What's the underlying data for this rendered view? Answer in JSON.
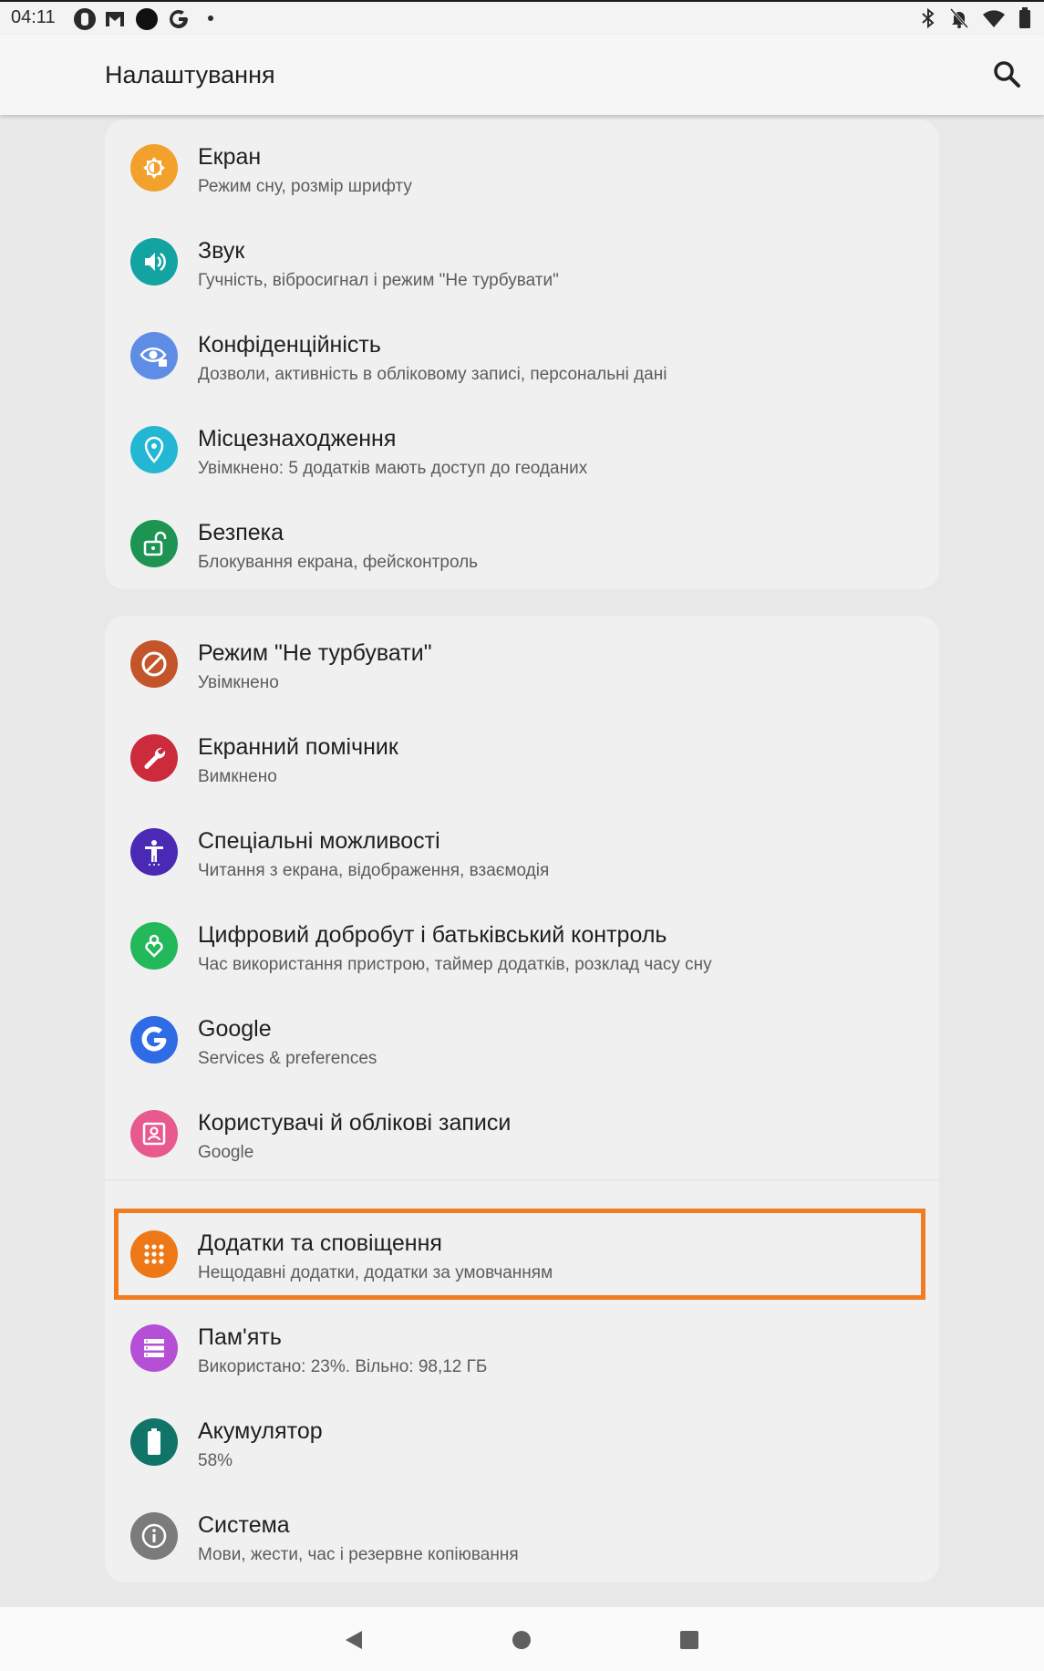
{
  "status_bar": {
    "time": "04:11",
    "left_icons": [
      "notification-icon",
      "gmail-icon",
      "circle-icon",
      "google-icon",
      "dot-icon"
    ],
    "right_icons": [
      "bluetooth-icon",
      "notifications-off-icon",
      "wifi-icon",
      "battery-icon"
    ]
  },
  "app_bar": {
    "title": "Налаштування",
    "search_icon": "search-icon"
  },
  "groups": [
    {
      "items": [
        {
          "title": "Екран",
          "subtitle": "Режим сну, розмір шрифту",
          "icon": "brightness-icon",
          "color": "#f2a22c"
        },
        {
          "title": "Звук",
          "subtitle": "Гучність, вібросигнал і режим \"Не турбувати\"",
          "icon": "volume-icon",
          "color": "#13a3a1"
        },
        {
          "title": "Конфіденційність",
          "subtitle": "Дозволи, активність в обліковому записі, персональні дані",
          "icon": "privacy-eye-icon",
          "color": "#5f8de6"
        },
        {
          "title": "Місцезнаходження",
          "subtitle": "Увімкнено: 5 додатків мають доступ до геоданих",
          "icon": "location-pin-icon",
          "color": "#24b7d3"
        },
        {
          "title": "Безпека",
          "subtitle": "Блокування екрана, фейсконтроль",
          "icon": "unlock-icon",
          "color": "#1d9452"
        }
      ]
    },
    {
      "items": [
        {
          "title": "Режим \"Не турбувати\"",
          "subtitle": "Увімкнено",
          "icon": "do-not-disturb-icon",
          "color": "#c4552a"
        },
        {
          "title": "Екранний помічник",
          "subtitle": "Вимкнено",
          "icon": "wrench-icon",
          "color": "#cc2b3c"
        },
        {
          "title": "Спеціальні можливості",
          "subtitle": "Читання з екрана, відображення, взаємодія",
          "icon": "accessibility-icon",
          "color": "#4a2ab4"
        },
        {
          "title": "Цифровий добробут і батьківський контроль",
          "subtitle": "Час використання пристрою, таймер додатків, розклад часу сну",
          "icon": "wellbeing-heart-icon",
          "color": "#23b85a"
        },
        {
          "title": "Google",
          "subtitle": "Services & preferences",
          "icon": "google-g-icon",
          "color": "#2e6be5"
        },
        {
          "title": "Користувачі й облікові записи",
          "subtitle": "Google",
          "icon": "account-icon",
          "color": "#e85a8e"
        }
      ]
    },
    {
      "items": [
        {
          "title": "Додатки та сповіщення",
          "subtitle": "Нещодавні додатки, додатки за умовчанням",
          "icon": "apps-grid-icon",
          "color": "#ee7818"
        },
        {
          "title": "Пам'ять",
          "subtitle": "Використано: 23%. Вільно: 98,12 ГБ",
          "icon": "storage-icon",
          "color": "#b54fd6"
        },
        {
          "title": "Акумулятор",
          "subtitle": "58%",
          "icon": "battery-icon",
          "color": "#107568"
        },
        {
          "title": "Система",
          "subtitle": "Мови, жести, час і резервне копіювання",
          "icon": "info-icon",
          "color": "#7b7b7b"
        }
      ]
    }
  ],
  "nav_bar": {
    "back_icon": "back-icon",
    "home_icon": "home-icon",
    "recents_icon": "recents-icon"
  },
  "highlight_color": "#f07c22"
}
